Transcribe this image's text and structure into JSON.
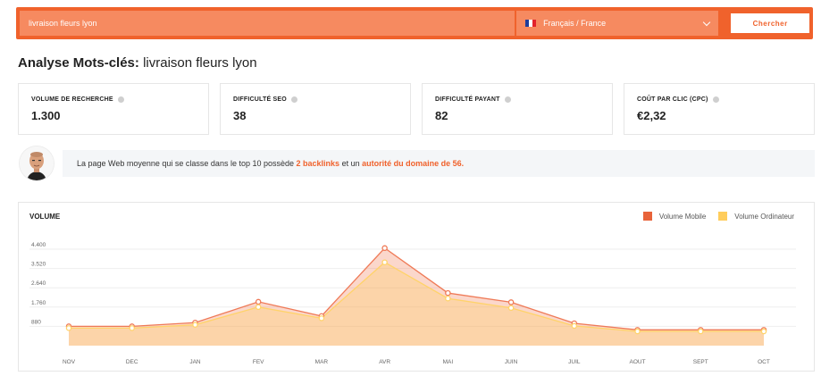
{
  "search": {
    "query": "livraison fleurs lyon",
    "language": "Français / France",
    "button_label": "Chercher"
  },
  "colors": {
    "accent": "#f0622c",
    "mobile": "#e8633a",
    "desktop": "#ffcd5c"
  },
  "title": {
    "prefix": "Analyse Mots-clés:",
    "keyword": "livraison fleurs lyon"
  },
  "metrics": [
    {
      "label": "VOLUME DE RECHERCHE",
      "value": "1.300"
    },
    {
      "label": "DIFFICULTÉ SEO",
      "value": "38"
    },
    {
      "label": "DIFFICULTÉ PAYANT",
      "value": "82"
    },
    {
      "label": "COÛT PAR CLIC (CPC)",
      "value": "€2,32"
    }
  ],
  "tip": {
    "part1": "La page Web moyenne qui se classe dans le top 10 possède",
    "backlinks": "2 backlinks",
    "part2": "et un",
    "authority": "autorité du domaine de 56",
    "end": "."
  },
  "chart_data": {
    "type": "area",
    "title": "VOLUME",
    "categories": [
      "NOV",
      "DEC",
      "JAN",
      "FEV",
      "MAR",
      "AVR",
      "MAI",
      "JUIN",
      "JUIL",
      "AOUT",
      "SEPT",
      "OCT"
    ],
    "y_ticks": [
      "880",
      "1.760",
      "2.640",
      "3.520",
      "4.400"
    ],
    "ylim": [
      0,
      4400
    ],
    "legend_position": "top-right",
    "series": [
      {
        "name": "Volume Mobile",
        "values": [
          880,
          880,
          1050,
          2000,
          1350,
          4450,
          2400,
          1980,
          1020,
          720,
          720,
          720
        ]
      },
      {
        "name": "Volume Ordinateur",
        "values": [
          800,
          800,
          950,
          1760,
          1250,
          3800,
          2150,
          1720,
          900,
          650,
          650,
          650
        ]
      }
    ]
  }
}
